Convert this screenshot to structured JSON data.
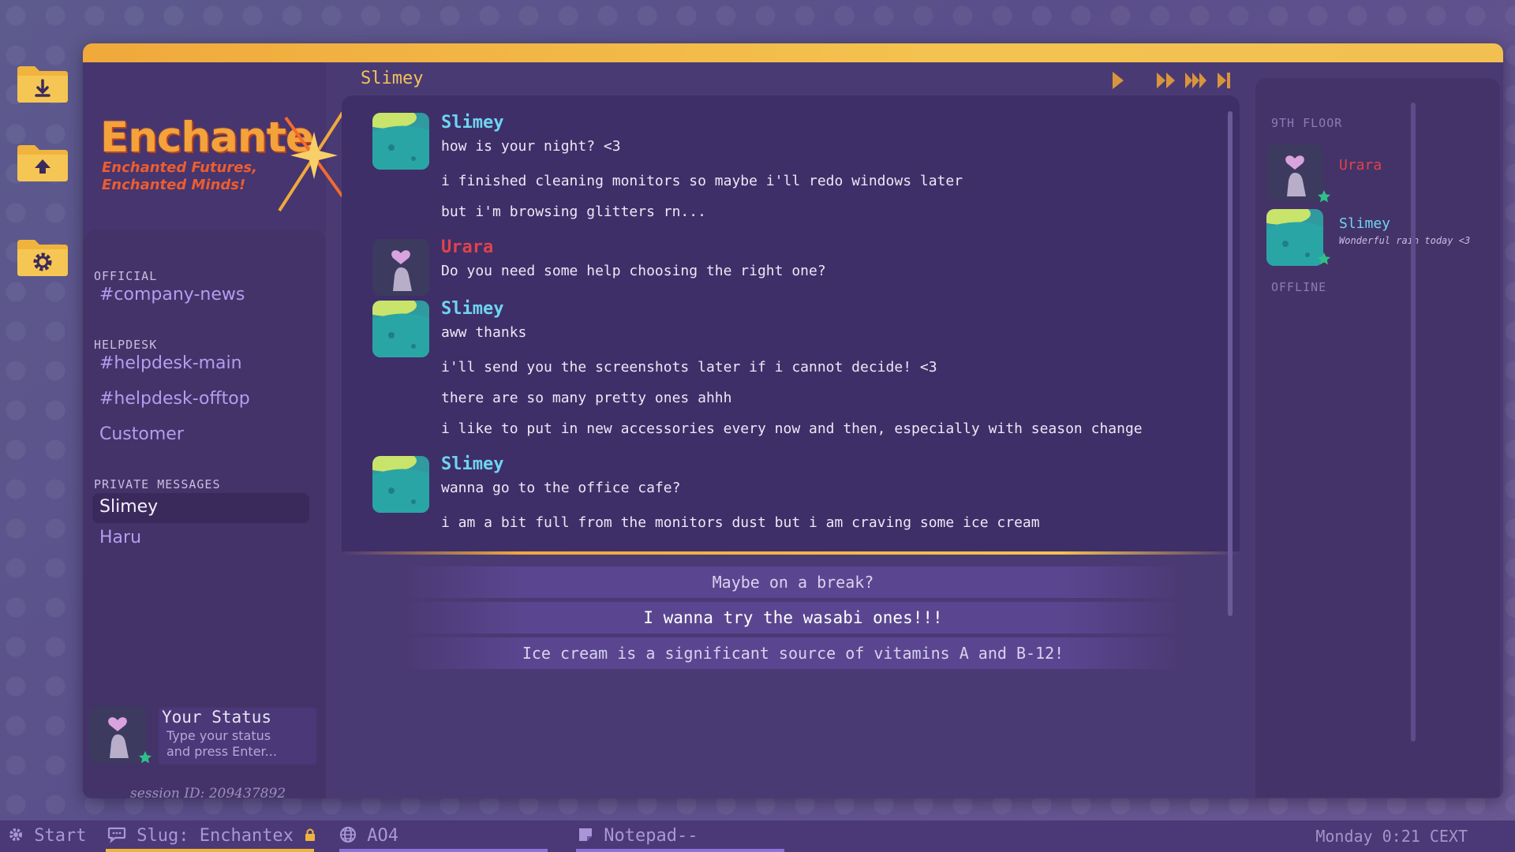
{
  "desktop": {
    "icons": [
      "download-folder-icon",
      "upload-folder-icon",
      "settings-folder-icon"
    ]
  },
  "logo": {
    "name": "Enchante",
    "tagline_1": "Enchanted Futures,",
    "tagline_2": "Enchanted Minds!"
  },
  "sidebar": {
    "sections": [
      {
        "label": "OFFICIAL",
        "items": [
          "#company-news"
        ]
      },
      {
        "label": "HELPDESK",
        "items": [
          "#helpdesk-main",
          "#helpdesk-offtop",
          "Customer"
        ]
      },
      {
        "label": "PRIVATE MESSAGES",
        "items": [
          "Slimey",
          "Haru"
        ]
      }
    ],
    "active": "Slimey",
    "status_title": "Your Status",
    "status_placeholder": "Type your status and press Enter...",
    "session": "session ID: 209437892"
  },
  "chat": {
    "title": "Slimey",
    "messages": [
      {
        "author": "Slimey",
        "lines": [
          "how is your night? <3",
          "i finished cleaning monitors so maybe i'll redo windows later",
          "but i'm browsing glitters rn..."
        ]
      },
      {
        "author": "Urara",
        "lines": [
          "Do you need some help choosing the right one?"
        ]
      },
      {
        "author": "Slimey",
        "lines": [
          "aww thanks",
          "i'll send you the screenshots later if i cannot decide! <3",
          "there are so many pretty ones ahhh",
          "i like to put in new accessories every now and then, especially with season change"
        ]
      },
      {
        "author": "Slimey",
        "lines": [
          "wanna go to the office cafe?",
          "i am a bit full from the monitors dust but i am craving some ice cream"
        ]
      }
    ],
    "colors": {
      "slimey": "#6fd4f2",
      "urara": "#e0434a"
    }
  },
  "replies": [
    "Maybe on a break?",
    "I wanna try the wasabi ones!!!",
    "Ice cream is a significant source of vitamins A and B-12!"
  ],
  "members": {
    "floor_label": "9TH FLOOR",
    "offline_label": "OFFLINE",
    "users": [
      {
        "name": "Urara",
        "status": ""
      },
      {
        "name": "Slimey",
        "status": "Wonderful rain today <3"
      }
    ]
  },
  "taskbar": {
    "start": "Start",
    "slug": "Slug: Enchantex",
    "browser": "AO4",
    "notepad": "Notepad--",
    "clock": "Monday 0:21 CEXT"
  }
}
